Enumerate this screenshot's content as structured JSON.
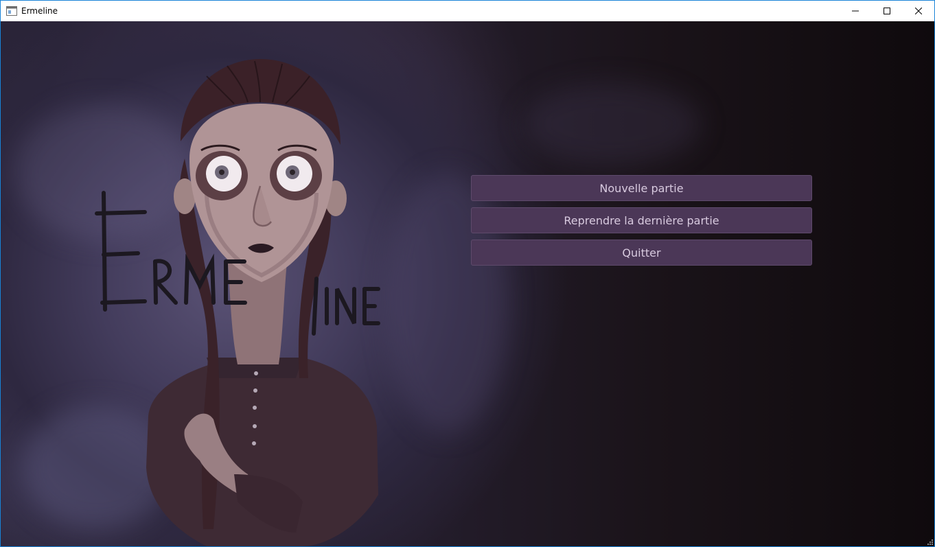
{
  "window": {
    "title": "Ermeline"
  },
  "title_controls": {
    "minimize": "minimize-icon",
    "maximize": "maximize-icon",
    "close": "close-icon"
  },
  "artwork": {
    "logo_text": "Ermeline"
  },
  "menu": {
    "new_game": "Nouvelle partie",
    "resume": "Reprendre la dernière partie",
    "quit": "Quitter"
  },
  "colors": {
    "button_bg": "#4b3757",
    "button_text": "#d8cadf",
    "window_border": "#1883d7"
  }
}
